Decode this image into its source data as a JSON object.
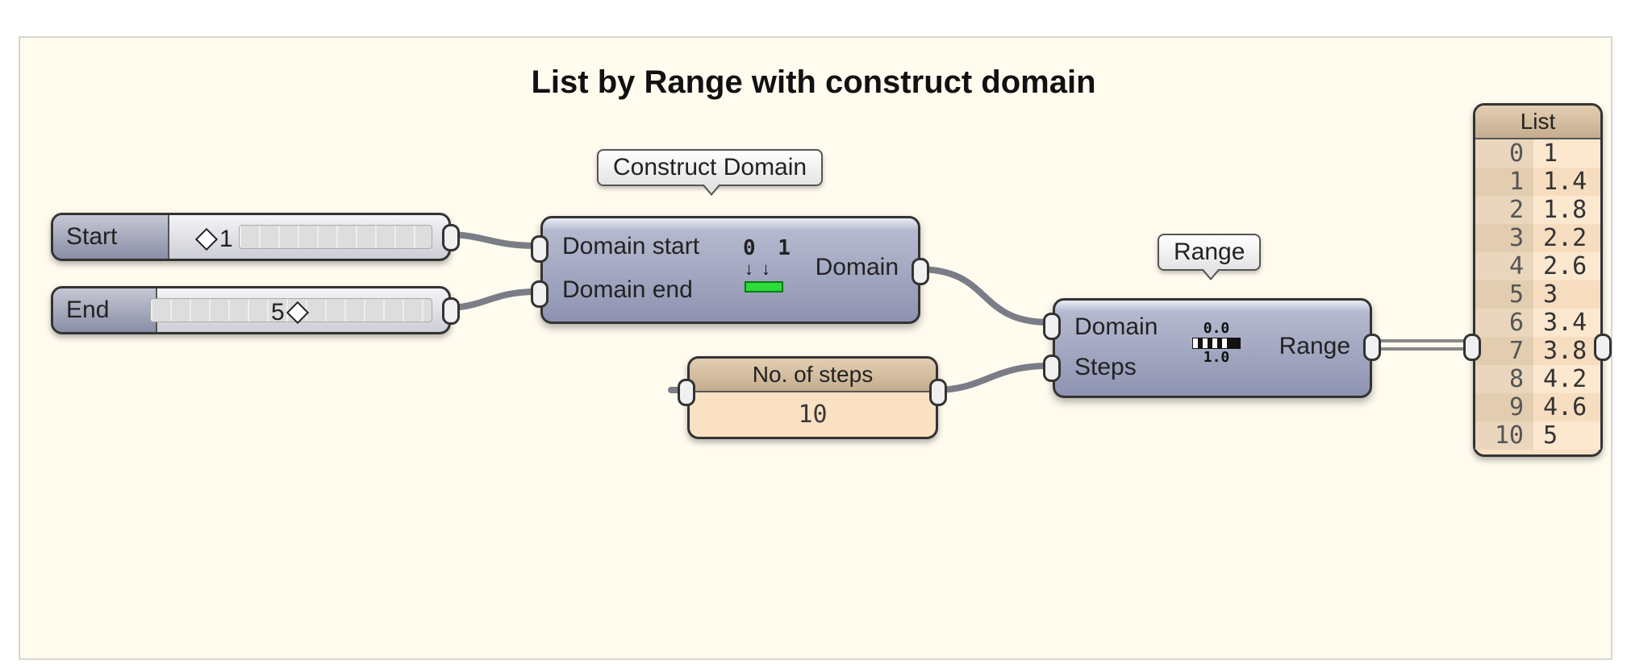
{
  "title": "List by Range with construct domain",
  "callouts": {
    "construct_domain": "Construct Domain",
    "range": "Range"
  },
  "sliders": {
    "start": {
      "label": "Start",
      "value": "1"
    },
    "end": {
      "label": "End",
      "value": "5"
    }
  },
  "construct_domain": {
    "in1": "Domain start",
    "in2": "Domain end",
    "out": "Domain",
    "icon_top": "0 1"
  },
  "range_comp": {
    "in1": "Domain",
    "in2": "Steps",
    "out": "Range",
    "icon_top": "0.0",
    "icon_bot": "1.0"
  },
  "steps_panel": {
    "title": "No. of steps",
    "value": "10"
  },
  "list_panel": {
    "title": "List",
    "rows": [
      {
        "i": "0",
        "v": "1"
      },
      {
        "i": "1",
        "v": "1.4"
      },
      {
        "i": "2",
        "v": "1.8"
      },
      {
        "i": "3",
        "v": "2.2"
      },
      {
        "i": "4",
        "v": "2.6"
      },
      {
        "i": "5",
        "v": "3"
      },
      {
        "i": "6",
        "v": "3.4"
      },
      {
        "i": "7",
        "v": "3.8"
      },
      {
        "i": "8",
        "v": "4.2"
      },
      {
        "i": "9",
        "v": "4.6"
      },
      {
        "i": "10",
        "v": "5"
      }
    ]
  }
}
